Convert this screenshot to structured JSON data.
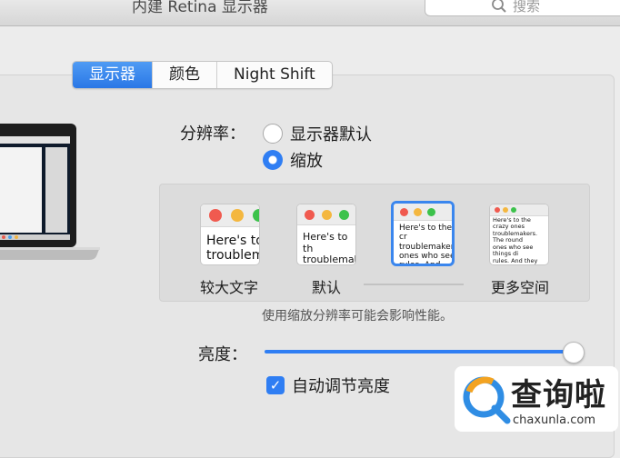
{
  "window": {
    "title": "内建 Retina 显示器"
  },
  "search": {
    "placeholder": "搜索"
  },
  "tabs": [
    {
      "label": "显示器",
      "active": true
    },
    {
      "label": "颜色",
      "active": false
    },
    {
      "label": "Night Shift",
      "active": false
    }
  ],
  "resolution": {
    "label": "分辨率：",
    "options": [
      {
        "label": "显示器默认",
        "selected": false
      },
      {
        "label": "缩放",
        "selected": true
      }
    ]
  },
  "scale_options": [
    {
      "caption": "较大文字",
      "preview_text": "Here's to\ntroublem",
      "selected": false
    },
    {
      "caption": "默认",
      "preview_text": "Here's to th\ntroublemak",
      "selected": false
    },
    {
      "caption": "",
      "preview_text": "Here's to the cr\ntroublemakers.\nones who see t\nrules. And they",
      "selected": true
    },
    {
      "caption": "更多空间",
      "preview_text": "Here's to the crazy ones\ntroublemakers. The round\nones who see things di\nrules. And they have no\ncan quote them, disagre\nthem. About the only th\nBecause they change t",
      "selected": false
    }
  ],
  "hint": "使用缩放分辨率可能会影响性能。",
  "brightness": {
    "label": "亮度：",
    "level": 1.0
  },
  "auto_brightness": {
    "label": "自动调节亮度",
    "checked": true
  },
  "watermark": {
    "main": "查询啦",
    "sub": "chaxunla.com"
  },
  "colors": {
    "accent": "#2f7ef3",
    "traffic_red": "#f05a4f",
    "traffic_yellow": "#f4b73f",
    "traffic_green": "#3cc24b"
  }
}
